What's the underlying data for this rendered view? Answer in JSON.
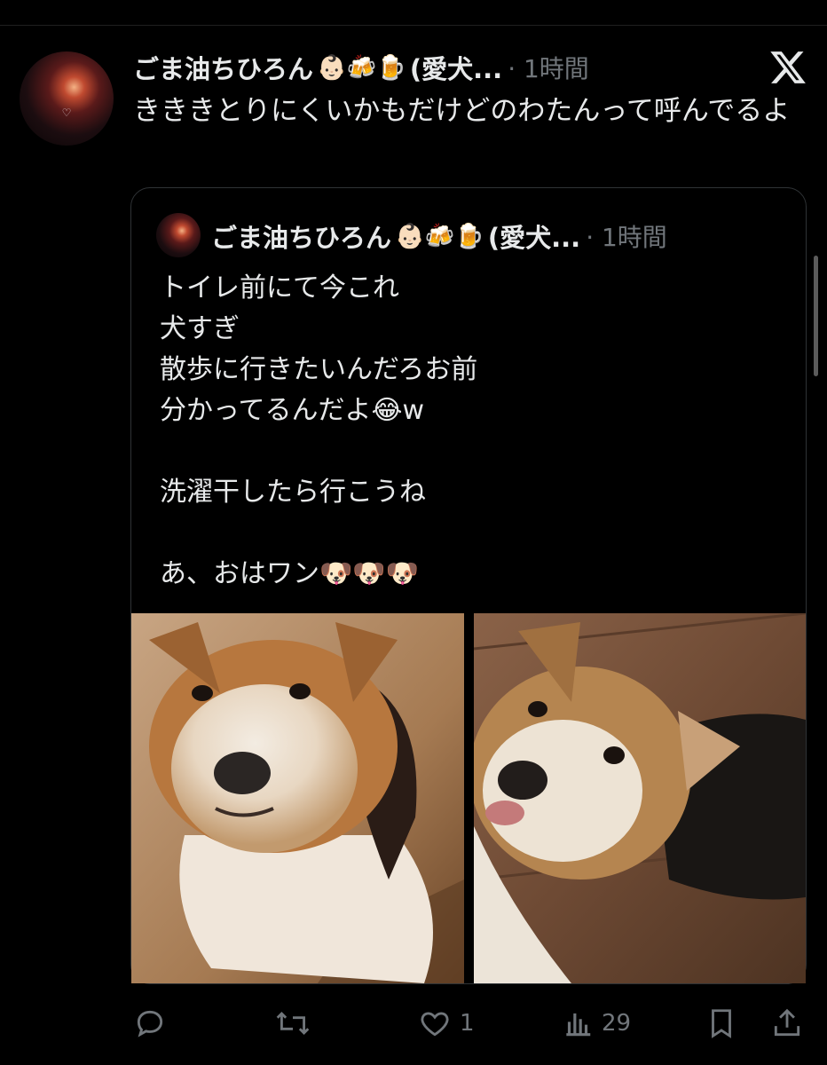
{
  "tweet": {
    "author_name": "ごま油ちひろん",
    "author_emojis": "👶🏻🍻🍺",
    "author_suffix": "(愛犬...",
    "meta": "· 1時間",
    "text": "きききとりにくいかもだけどのわたんって呼んでるよ"
  },
  "quote": {
    "author_name": "ごま油ちひろん",
    "author_emojis": "👶🏻🍻🍺",
    "author_suffix": "(愛犬...",
    "meta": "· 1時間",
    "lines": [
      "トイレ前にて今これ",
      "犬すぎ",
      "散歩に行きたいんだろお前",
      "分かってるんだよ😂w",
      "",
      "洗濯干したら行こうね",
      "",
      "あ、おはワン🐶🐶🐶"
    ]
  },
  "actions": {
    "reply_count": "",
    "retweet_count": "",
    "like_count": "1",
    "views_count": "29"
  },
  "icons": {
    "brand": "x-logo-icon",
    "reply": "reply-icon",
    "retweet": "retweet-icon",
    "like": "heart-icon",
    "views": "views-icon",
    "bookmark": "bookmark-icon",
    "share": "share-icon"
  },
  "colors": {
    "background": "#000000",
    "text": "#e7e9ea",
    "muted": "#71767b",
    "border": "#2f3336"
  }
}
